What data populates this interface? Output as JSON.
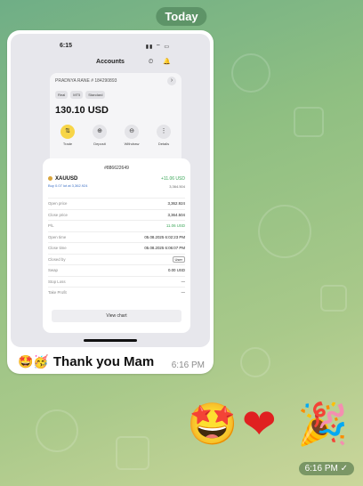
{
  "chat": {
    "date_label": "Today",
    "message1": {
      "emojis": "🤩🥳",
      "text": "Thank you Mam",
      "time": "6:16 PM"
    },
    "message2": {
      "emoji_star": "🤩",
      "emoji_heart": "❤",
      "emoji_party": "🎉",
      "time": "6:16 PM ✓"
    }
  },
  "screenshot": {
    "status_time": "6:15",
    "status_icons": "▮▮ ⌔ ▭",
    "header_title": "Accounts",
    "header_icons": {
      "clock": "⏲",
      "bell": "🔔"
    },
    "account": {
      "name": "PRADNYA RANE # 184290893",
      "chips": [
        "Real",
        "MT5",
        "Standard"
      ],
      "balance": "130.10 USD",
      "actions": [
        {
          "label": "Trade",
          "icon": "⇅"
        },
        {
          "label": "Deposit",
          "icon": "⊕"
        },
        {
          "label": "Withdraw",
          "icon": "⊖"
        },
        {
          "label": "Details",
          "icon": "⋮"
        }
      ]
    },
    "position": {
      "id": "#886622649",
      "symbol": "XAUUSD",
      "profit": "+11.06 USD",
      "sub": "Buy 0.07 lot at 3,362.924",
      "sub_right": "3,364.504",
      "rows": [
        {
          "label": "Open price",
          "value": "3,362.924",
          "style": ""
        },
        {
          "label": "Close price",
          "value": "3,364.504",
          "style": ""
        },
        {
          "label": "P/L",
          "value": "11.06 USD",
          "style": "green"
        },
        {
          "label": "Open time",
          "value": "05.08.2025 6:02:23 PM",
          "style": ""
        },
        {
          "label": "Close time",
          "value": "05.08.2025 6:06:07 PM",
          "style": ""
        },
        {
          "label": "Closed by",
          "value": "User",
          "style": "badge"
        },
        {
          "label": "Swap",
          "value": "0.00 USD",
          "style": ""
        },
        {
          "label": "Stop Loss",
          "value": "—",
          "style": ""
        },
        {
          "label": "Take Profit",
          "value": "—",
          "style": ""
        }
      ],
      "view_chart": "View chart"
    }
  }
}
